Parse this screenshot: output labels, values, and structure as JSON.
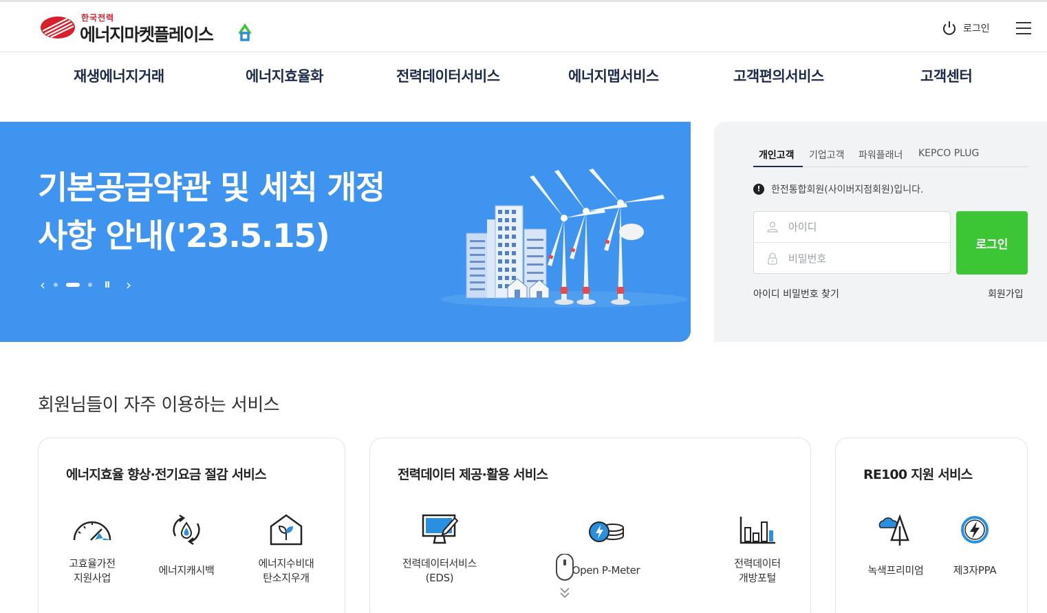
{
  "header": {
    "logo_small": "한국전력",
    "logo_big": "에너지마켓플레이스",
    "login_label": "로그인"
  },
  "gnb": [
    {
      "label": "재생에너지거래"
    },
    {
      "label": "에너지효율화"
    },
    {
      "label": "전력데이터서비스"
    },
    {
      "label": "에너지맵서비스"
    },
    {
      "label": "고객편의서비스"
    },
    {
      "label": "고객센터"
    }
  ],
  "hero": {
    "title_line1": "기본공급약관 및 세칙 개정",
    "title_line2": "사항 안내('23.5.15)",
    "prev": "‹",
    "next": "›",
    "pause": "II"
  },
  "login_panel": {
    "tabs": [
      {
        "label": "개인고객",
        "active": true
      },
      {
        "label": "기업고객"
      },
      {
        "label": "파워플래너"
      },
      {
        "label": "KEPCO PLUG"
      }
    ],
    "notice": "한전통합회원(사이버지점회원)입니다.",
    "id_placeholder": "아이디",
    "pw_placeholder": "비밀번호",
    "login_button": "로그인",
    "find_link": "아이디 비밀번호 찾기",
    "join_link": "회원가입"
  },
  "services": {
    "section_title": "회원님들이 자주 이용하는 서비스",
    "cards": [
      {
        "title": "에너지효율 향상·전기요금 절감 서비스",
        "items": [
          {
            "label": "고효율가전\n지원사업",
            "icon": "speedometer-icon"
          },
          {
            "label": "에너지캐시백",
            "icon": "water-drop-cycle-icon"
          },
          {
            "label": "에너지수비대\n탄소지우개",
            "icon": "eco-house-icon"
          }
        ]
      },
      {
        "title": "전력데이터 제공·활용 서비스",
        "items": [
          {
            "label": "전력데이터서비스\n(EDS)",
            "icon": "monitor-pen-icon"
          },
          {
            "label": "Open P-Meter",
            "icon": "energy-coin-icon"
          },
          {
            "label": "전력데이터\n개방포털",
            "icon": "bar-chart-icon"
          }
        ]
      },
      {
        "title": "RE100 지원 서비스",
        "items": [
          {
            "label": "녹색프리미엄",
            "icon": "cloud-tree-icon"
          },
          {
            "label": "제3자PPA",
            "icon": "lightning-circle-icon"
          }
        ]
      }
    ]
  },
  "colors": {
    "brand_red": "#d7202a",
    "hero_blue": "#3e94ee",
    "login_green": "#3cc635",
    "navy": "#1c2b4a",
    "icon_blue": "#2b8fe0"
  }
}
